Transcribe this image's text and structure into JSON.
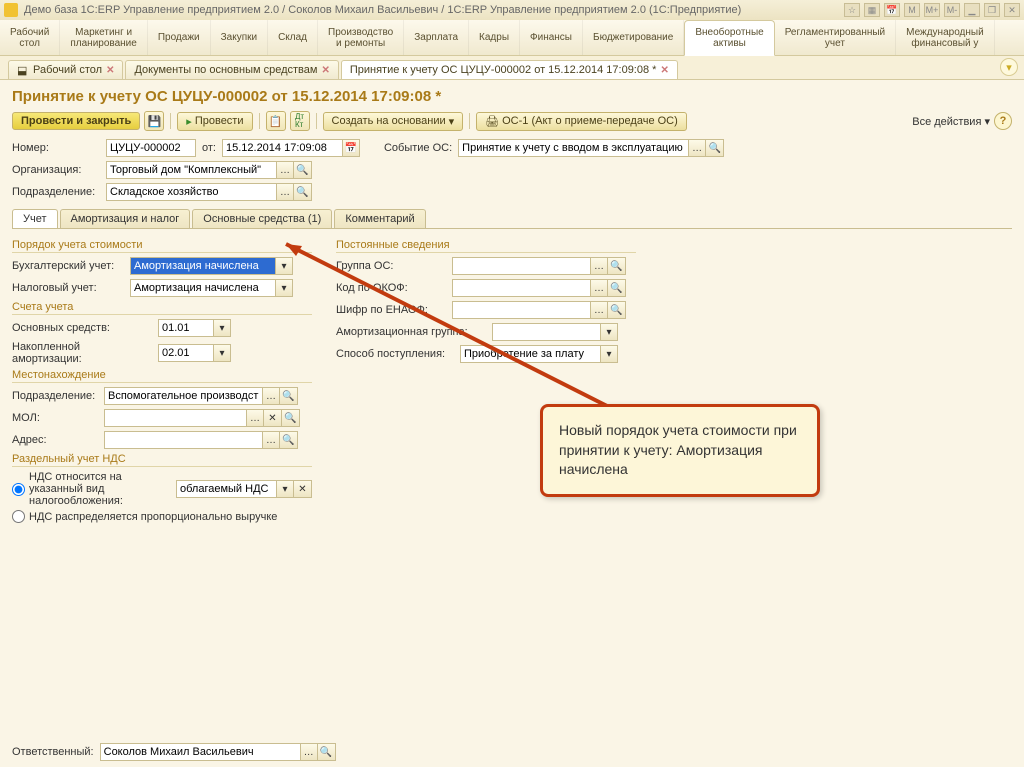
{
  "titlebar": {
    "text": "Демо база 1С:ERP Управление предприятием 2.0 / Соколов Михаил Васильевич / 1С:ERP Управление предприятием 2.0  (1С:Предприятие)",
    "sys_m": "M",
    "sys_mp": "M+",
    "sys_mm": "M-"
  },
  "mainmenu": [
    {
      "label": "Рабочий\nстол"
    },
    {
      "label": "Маркетинг и\nпланирование"
    },
    {
      "label": "Продажи"
    },
    {
      "label": "Закупки"
    },
    {
      "label": "Склад"
    },
    {
      "label": "Производство\nи ремонты"
    },
    {
      "label": "Зарплата"
    },
    {
      "label": "Кадры"
    },
    {
      "label": "Финансы"
    },
    {
      "label": "Бюджетирование"
    },
    {
      "label": "Внеоборотные\nактивы",
      "active": true
    },
    {
      "label": "Регламентированный\nучет"
    },
    {
      "label": "Международный\nфинансовый у"
    }
  ],
  "doctabs": [
    {
      "label": "Рабочий стол"
    },
    {
      "label": "Документы по основным средствам"
    },
    {
      "label": "Принятие к учету ОС ЦУЦУ-000002 от 15.12.2014 17:09:08 *",
      "active": true
    }
  ],
  "doc_title": "Принятие к учету ОС ЦУЦУ-000002 от 15.12.2014 17:09:08 *",
  "toolbar": {
    "confirm_close": "Провести и закрыть",
    "confirm": "Провести",
    "create_based": "Создать на основании",
    "os1": "ОС-1 (Акт о приеме-передаче ОС)",
    "all_actions": "Все действия"
  },
  "header": {
    "number_label": "Номер:",
    "number": "ЦУЦУ-000002",
    "from_label": "от:",
    "from": "15.12.2014 17:09:08",
    "event_label": "Событие ОС:",
    "event": "Принятие к учету с вводом в эксплуатацию",
    "org_label": "Организация:",
    "org": "Торговый дом \"Комплексный\"",
    "div_label": "Подразделение:",
    "div": "Складское хозяйство"
  },
  "subtabs": [
    "Учет",
    "Амортизация и налог",
    "Основные средства (1)",
    "Комментарий"
  ],
  "left": {
    "g1_title": "Порядок учета стоимости",
    "acc_label": "Бухгалтерский учет:",
    "acc_val": "Амортизация начислена",
    "tax_label": "Налоговый учет:",
    "tax_val": "Амортизация начислена",
    "g2_title": "Счета учета",
    "os_label": "Основных средств:",
    "os_val": "01.01",
    "amort_label": "Накопленной амортизации:",
    "amort_val": "02.01",
    "g3_title": "Местонахождение",
    "div_label": "Подразделение:",
    "div_val": "Вспомогательное производство",
    "mol_label": "МОЛ:",
    "mol_val": "",
    "addr_label": "Адрес:",
    "addr_val": "",
    "g4_title": "Раздельный учет НДС",
    "radio1": "НДС относится на указанный вид налогообложения:",
    "radio1_val": "облагаемый НДС",
    "radio2": "НДС распределяется пропорционально выручке"
  },
  "right": {
    "g1_title": "Постоянные сведения",
    "group_label": "Группа ОС:",
    "okof_label": "Код по ОКОФ:",
    "enaof_label": "Шифр по ЕНАОФ:",
    "amgrp_label": "Амортизационная группа:",
    "method_label": "Способ поступления:",
    "method_val": "Приобретение за плату"
  },
  "footer": {
    "resp_label": "Ответственный:",
    "resp_val": "Соколов Михаил Васильевич"
  },
  "callout": "Новый порядок учета стоимости при принятии к учету: Амортизация начислена"
}
